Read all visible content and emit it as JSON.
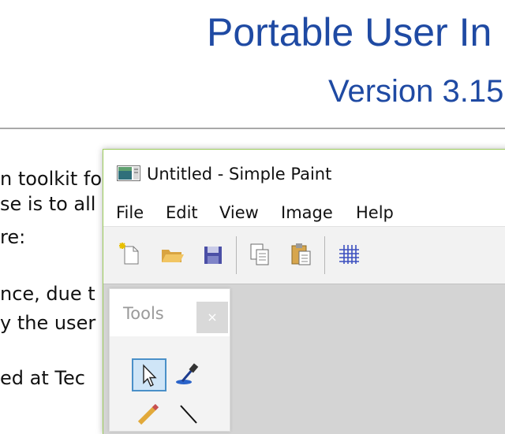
{
  "document": {
    "title": "Portable User In",
    "subtitle": "Version 3.15",
    "body_lines": [
      "n toolkit fo",
      "se is to all",
      "re:",
      "nce, due t",
      "y the user",
      "ed at Tec"
    ]
  },
  "window": {
    "title": "Untitled - Simple Paint",
    "menu": [
      "File",
      "Edit",
      "View",
      "Image",
      "Help"
    ],
    "toolbar": [
      "new-file",
      "open-folder",
      "save",
      "copy",
      "paste",
      "grid"
    ]
  },
  "tools_panel": {
    "title": "Tools",
    "close_label": "×",
    "tools": [
      "select-pointer",
      "eyedropper",
      "pencil",
      "line"
    ],
    "selected_tool": "select-pointer"
  },
  "colors": {
    "heading": "#1f4aa3",
    "window_border": "#9ccc5b",
    "selection": "#4a90c8",
    "canvas": "#d4d4d4"
  }
}
